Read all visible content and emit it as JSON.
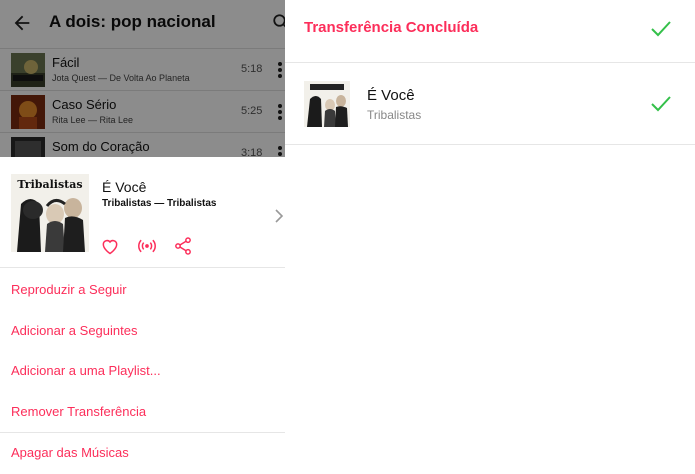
{
  "left": {
    "appbar": {
      "title": "A dois: pop nacional"
    },
    "tracks": [
      {
        "title": "Fácil",
        "subtitle": "Jota Quest — De Volta Ao Planeta",
        "duration": "5:18"
      },
      {
        "title": "Caso Sério",
        "subtitle": "Rita Lee — Rita Lee",
        "duration": "5:25"
      },
      {
        "title": "Som do Coração",
        "subtitle": "",
        "duration": "3:18"
      }
    ],
    "sheet": {
      "title": "É Você",
      "subtitle": "Tribalistas — Tribalistas",
      "album_logo": "Tribalistas",
      "menu": [
        "Reproduzir a Seguir",
        "Adicionar a Seguintes",
        "Adicionar a uma Playlist...",
        "Remover Transferência",
        "Apagar das Músicas"
      ]
    }
  },
  "right": {
    "header": "Transferência Concluída",
    "item": {
      "title": "É Você",
      "subtitle": "Tribalistas"
    }
  },
  "colors": {
    "accent": "#fc2e5a",
    "check": "#34c04a"
  },
  "icons": [
    "back-arrow-icon",
    "search-icon",
    "more-vert-icon",
    "heart-icon",
    "broadcast-icon",
    "share-icon",
    "chevron-right-icon",
    "check-icon"
  ]
}
